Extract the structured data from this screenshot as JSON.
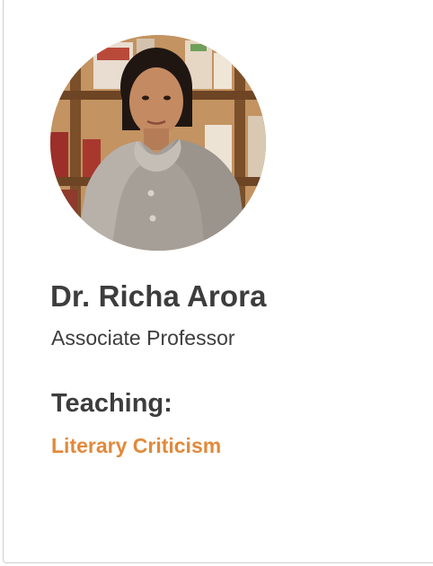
{
  "profile": {
    "name": "Dr. Richa Arora",
    "designation": "Associate Professor",
    "teaching_heading": "Teaching:",
    "teaching_subject": "Literary Criticism",
    "photo_icon": "portrait-photo"
  },
  "colors": {
    "text": "#3d3d3d",
    "accent": "#e2893a",
    "card_border": "#cfcfcf",
    "background": "#ffffff"
  }
}
